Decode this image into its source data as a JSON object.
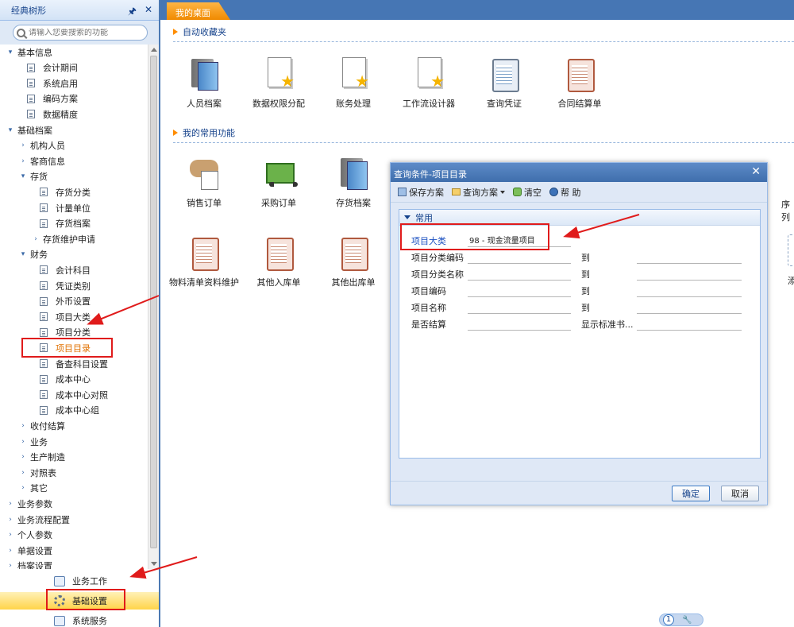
{
  "left_panel": {
    "title": "经典树形",
    "pin_glyph": "🖈",
    "close_glyph": "✕",
    "search_placeholder": "请输入您要搜索的功能"
  },
  "tree": [
    {
      "label": "基本信息",
      "level": 0,
      "arrow": "▾",
      "kind": "folder"
    },
    {
      "label": "会计期间",
      "level": 1,
      "arrow": "",
      "kind": "doc"
    },
    {
      "label": "系统启用",
      "level": 1,
      "arrow": "",
      "kind": "doc"
    },
    {
      "label": "编码方案",
      "level": 1,
      "arrow": "",
      "kind": "doc"
    },
    {
      "label": "数据精度",
      "level": 1,
      "arrow": "",
      "kind": "doc"
    },
    {
      "label": "基础档案",
      "level": 0,
      "arrow": "▾",
      "kind": "folder"
    },
    {
      "label": "机构人员",
      "level": 1,
      "arrow": "›",
      "kind": "folder"
    },
    {
      "label": "客商信息",
      "level": 1,
      "arrow": "›",
      "kind": "folder"
    },
    {
      "label": "存货",
      "level": 1,
      "arrow": "▾",
      "kind": "folder"
    },
    {
      "label": "存货分类",
      "level": 2,
      "arrow": "",
      "kind": "doc"
    },
    {
      "label": "计量单位",
      "level": 2,
      "arrow": "",
      "kind": "doc"
    },
    {
      "label": "存货档案",
      "level": 2,
      "arrow": "",
      "kind": "doc"
    },
    {
      "label": "存货维护申请",
      "level": 2,
      "arrow": "›",
      "kind": "folder"
    },
    {
      "label": "财务",
      "level": 1,
      "arrow": "▾",
      "kind": "folder"
    },
    {
      "label": "会计科目",
      "level": 2,
      "arrow": "",
      "kind": "doc"
    },
    {
      "label": "凭证类别",
      "level": 2,
      "arrow": "",
      "kind": "doc"
    },
    {
      "label": "外币设置",
      "level": 2,
      "arrow": "",
      "kind": "doc"
    },
    {
      "label": "项目大类",
      "level": 2,
      "arrow": "",
      "kind": "doc"
    },
    {
      "label": "项目分类",
      "level": 2,
      "arrow": "",
      "kind": "doc"
    },
    {
      "label": "项目目录",
      "level": 2,
      "arrow": "",
      "kind": "doc",
      "selected": true
    },
    {
      "label": "备查科目设置",
      "level": 2,
      "arrow": "",
      "kind": "doc"
    },
    {
      "label": "成本中心",
      "level": 2,
      "arrow": "",
      "kind": "doc"
    },
    {
      "label": "成本中心对照",
      "level": 2,
      "arrow": "",
      "kind": "doc"
    },
    {
      "label": "成本中心组",
      "level": 2,
      "arrow": "",
      "kind": "doc"
    },
    {
      "label": "收付结算",
      "level": 1,
      "arrow": "›",
      "kind": "folder"
    },
    {
      "label": "业务",
      "level": 1,
      "arrow": "›",
      "kind": "folder"
    },
    {
      "label": "生产制造",
      "level": 1,
      "arrow": "›",
      "kind": "folder"
    },
    {
      "label": "对照表",
      "level": 1,
      "arrow": "›",
      "kind": "folder"
    },
    {
      "label": "其它",
      "level": 1,
      "arrow": "›",
      "kind": "folder"
    },
    {
      "label": "业务参数",
      "level": 0,
      "arrow": "›",
      "kind": "folder"
    },
    {
      "label": "业务流程配置",
      "level": 0,
      "arrow": "›",
      "kind": "folder"
    },
    {
      "label": "个人参数",
      "level": 0,
      "arrow": "›",
      "kind": "folder"
    },
    {
      "label": "单据设置",
      "level": 0,
      "arrow": "›",
      "kind": "folder"
    },
    {
      "label": "档案设置",
      "level": 0,
      "arrow": "›",
      "kind": "folder"
    }
  ],
  "bottom_nav": {
    "business": "业务工作",
    "basic": "基础设置",
    "system": "系统服务"
  },
  "tabs": {
    "desktop": "我的桌面"
  },
  "desktop": {
    "favorites_title": "自动收藏夹",
    "favorites": [
      {
        "label": "人员档案",
        "icon": "books-icon"
      },
      {
        "label": "数据权限分配",
        "icon": "doc-star-icon"
      },
      {
        "label": "账务处理",
        "icon": "doc-star-icon"
      },
      {
        "label": "工作流设计器",
        "icon": "doc-star-icon"
      },
      {
        "label": "查询凭证",
        "icon": "clipboard-icon"
      },
      {
        "label": "合同结算单",
        "icon": "clipboard-red-icon"
      }
    ],
    "common_title": "我的常用功能",
    "common_row1": [
      {
        "label": "销售订单",
        "icon": "handshake-icon"
      },
      {
        "label": "采购订单",
        "icon": "cart-icon"
      },
      {
        "label": "存货档案",
        "icon": "books-icon"
      }
    ],
    "common_row2": [
      {
        "label": "物料清单资料维护",
        "icon": "clipboard-red-icon"
      },
      {
        "label": "其他入库单",
        "icon": "clipboard-red-icon"
      },
      {
        "label": "其他出库单",
        "icon": "clipboard-red-icon"
      }
    ],
    "partial_label_1": "序列",
    "partial_label_2": "添"
  },
  "dialog": {
    "title": "查询条件-项目目录",
    "close_glyph": "✕",
    "toolbar": {
      "save": "保存方案",
      "query": "查询方案",
      "clear": "清空",
      "help": "帮 助"
    },
    "group": "常用",
    "fields": [
      {
        "label": "项目大类",
        "value": "98 - 现金流量项目",
        "to": "",
        "value2": "",
        "link": true
      },
      {
        "label": "项目分类编码",
        "value": "",
        "to": "到",
        "value2": ""
      },
      {
        "label": "项目分类名称",
        "value": "",
        "to": "到",
        "value2": ""
      },
      {
        "label": "项目编码",
        "value": "",
        "to": "到",
        "value2": ""
      },
      {
        "label": "项目名称",
        "value": "",
        "to": "到",
        "value2": ""
      },
      {
        "label": "是否结算",
        "value": "",
        "to": "显示标准书...",
        "value2": ""
      }
    ],
    "ok": "确定",
    "cancel": "取消"
  },
  "pager": {
    "page": "1"
  },
  "colors": {
    "accent": "#4676b4",
    "tab_active": "#f08a00",
    "annotation": "#e01b1b"
  }
}
